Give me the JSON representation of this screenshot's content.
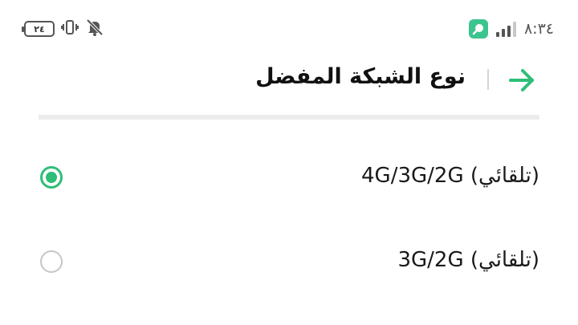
{
  "status_bar": {
    "time": "٨:٣٤",
    "battery": "٢٤",
    "signal_icon": "cellular-signal-icon",
    "app_icon": "search-app-icon",
    "vibrate_icon": "vibrate-icon",
    "mute_icon": "muted-bell-icon"
  },
  "header": {
    "title": "نوع الشبكة المفضل",
    "back_icon": "arrow-right-icon"
  },
  "options": [
    {
      "label": "(تلقائي) 4G/3G/2G",
      "selected": true
    },
    {
      "label": "(تلقائي) 3G/2G",
      "selected": false
    }
  ],
  "colors": {
    "accent": "#2fbd77",
    "text": "#1a1a1a",
    "divider": "#ececec"
  }
}
